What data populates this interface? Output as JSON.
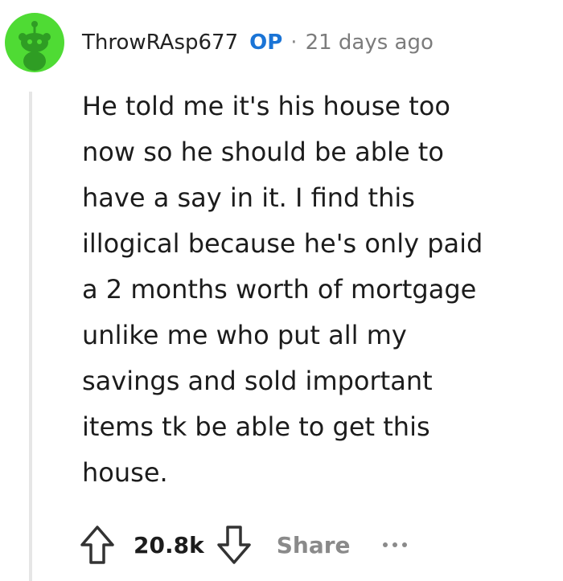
{
  "comment": {
    "author": "ThrowRAsp677",
    "op_badge": "OP",
    "separator": "·",
    "timestamp": "21 days ago",
    "body_lines": [
      "He told me it's his house too",
      "now so he should be able to",
      "have a say in it. I find this",
      "illogical because he's only paid",
      "a 2 months worth of mortgage",
      "unlike me who put all my",
      "savings and sold important",
      "items tk be able to get this",
      "house."
    ],
    "score": "20.8k",
    "share_label": "Share"
  },
  "colors": {
    "avatar_bg": "#4fdb34",
    "avatar_figure": "#2f9d24",
    "op_blue": "#1a74d6",
    "muted_gray": "#8a8a8a"
  },
  "icons": {
    "avatar": "reddit-snoo-icon",
    "upvote": "upvote-arrow-icon",
    "downvote": "downvote-arrow-icon",
    "more": "more-options-icon"
  }
}
